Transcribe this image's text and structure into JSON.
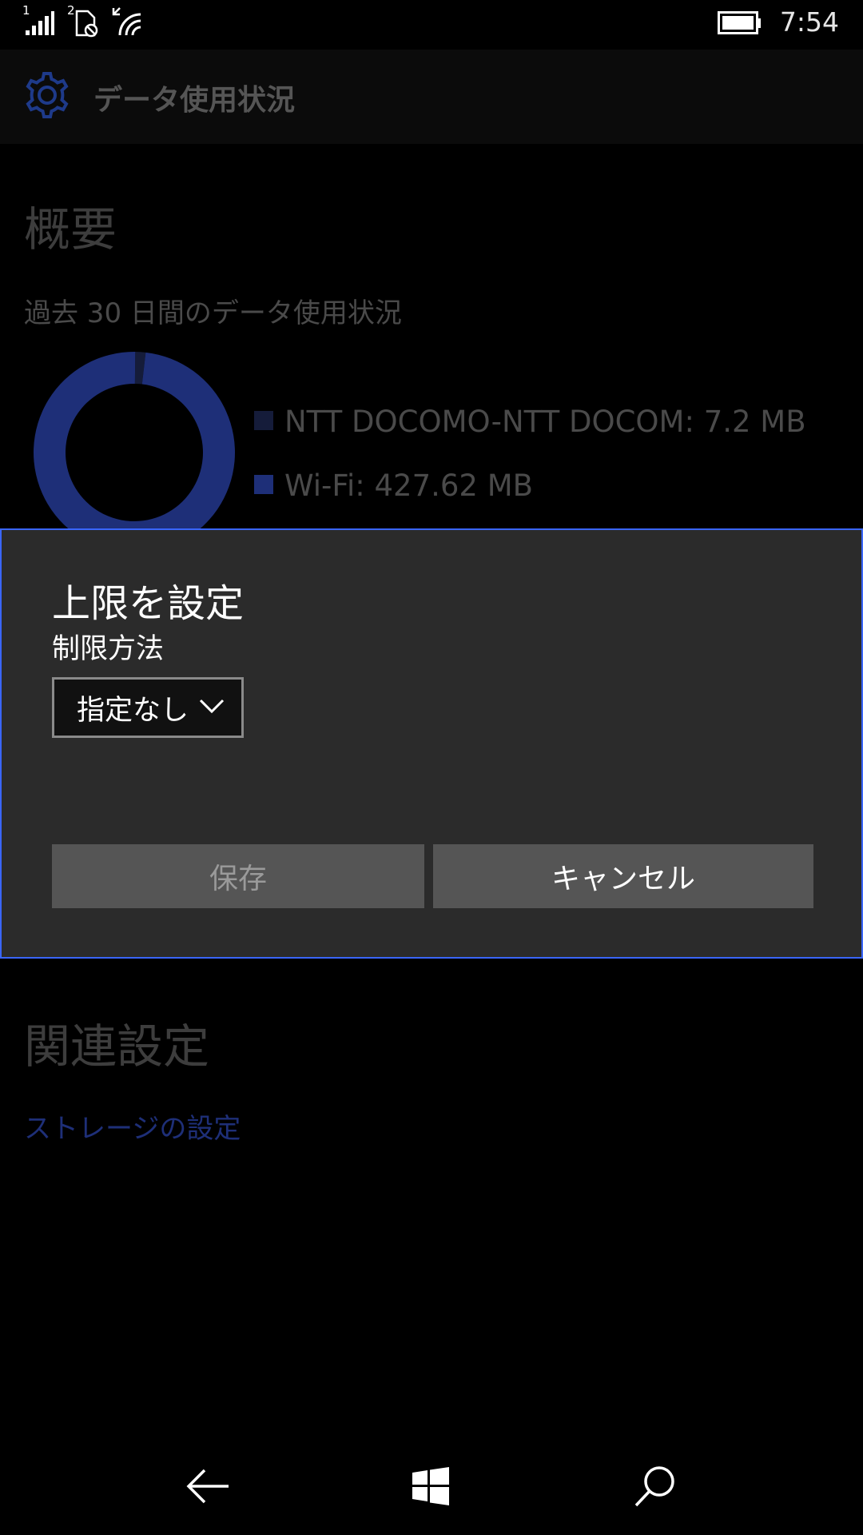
{
  "status_bar": {
    "sim1_label": "1",
    "sim2_label": "2",
    "time": "7:54",
    "icons": [
      "signal-icon",
      "sim-icon",
      "wifi-icon",
      "battery-icon"
    ]
  },
  "header": {
    "title": "データ使用状況",
    "icon": "gear-icon",
    "accent_color": "#1e3a8a"
  },
  "overview": {
    "title": "概要",
    "subtitle": "過去 30 日間のデータ使用状況",
    "legend": [
      {
        "label": "NTT DOCOMO-NTT DOCOM: 7.2 MB",
        "color": "#151c3a"
      },
      {
        "label": "Wi-Fi: 427.62 MB",
        "color": "#1e2f78"
      }
    ]
  },
  "chart_data": {
    "type": "pie",
    "labels": [
      "NTT DOCOMO-NTT DOCOM",
      "Wi-Fi"
    ],
    "values": [
      7.2,
      427.62
    ],
    "colors": [
      "#151c3a",
      "#1e2f78"
    ],
    "donut": true
  },
  "dialog": {
    "title": "上限を設定",
    "label": "制限方法",
    "select_value": "指定なし",
    "save_label": "保存",
    "cancel_label": "キャンセル"
  },
  "related": {
    "title": "関連設定",
    "storage_link": "ストレージの設定"
  },
  "nav_bar": {
    "icons": [
      "back-icon",
      "windows-icon",
      "search-icon"
    ]
  }
}
